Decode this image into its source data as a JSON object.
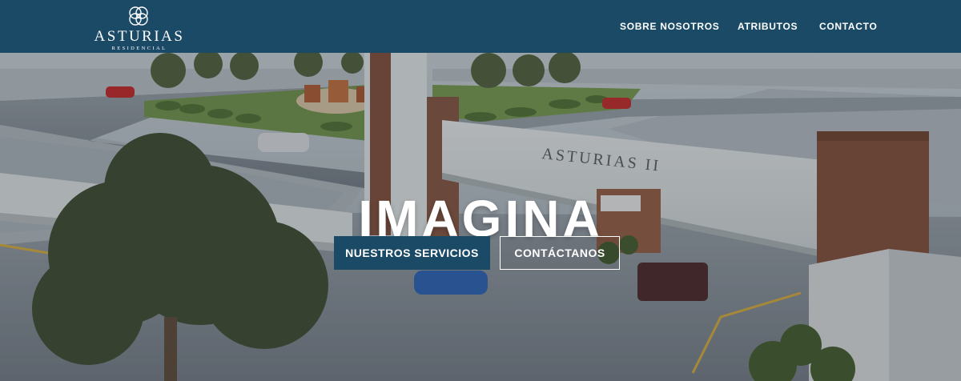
{
  "header": {
    "logo": {
      "name": "ASTURIAS",
      "subtitle": "RESIDENCIAL",
      "icon": "interlaced-circles-icon"
    },
    "nav": [
      {
        "label": "SOBRE NOSOTROS"
      },
      {
        "label": "ATRIBUTOS"
      },
      {
        "label": "CONTACTO"
      }
    ]
  },
  "hero": {
    "gate_sign": "ASTURIAS II",
    "title": "IMAGINA",
    "buttons": {
      "primary": "NUESTROS SERVICIOS",
      "secondary": "CONTÁCTANOS"
    }
  },
  "colors": {
    "brand_navy": "#1b4a66",
    "text_light": "#ffffff"
  }
}
